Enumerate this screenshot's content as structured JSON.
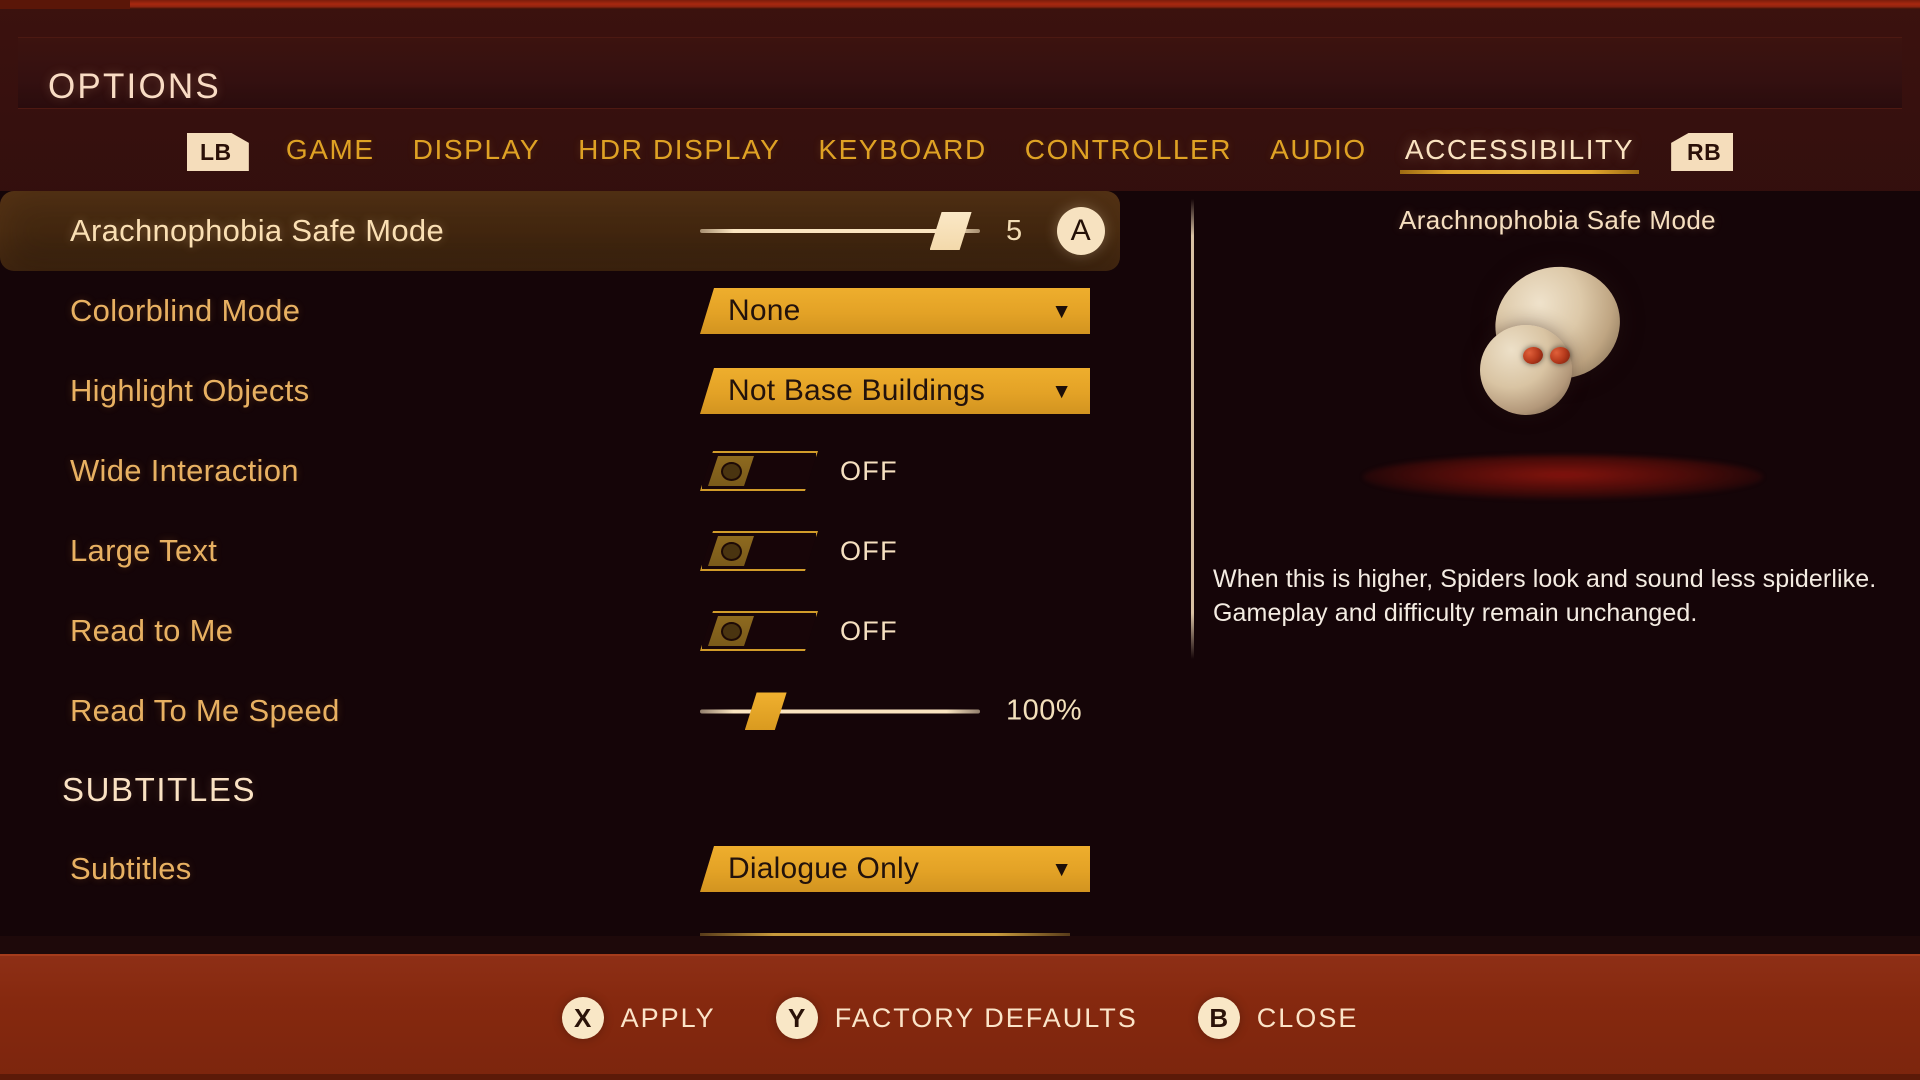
{
  "header": {
    "title": "OPTIONS"
  },
  "tabs": {
    "left_bumper": "LB",
    "right_bumper": "RB",
    "items": [
      {
        "label": "GAME",
        "active": false
      },
      {
        "label": "DISPLAY",
        "active": false
      },
      {
        "label": "HDR DISPLAY",
        "active": false
      },
      {
        "label": "KEYBOARD",
        "active": false
      },
      {
        "label": "CONTROLLER",
        "active": false
      },
      {
        "label": "AUDIO",
        "active": false
      },
      {
        "label": "ACCESSIBILITY",
        "active": true
      }
    ]
  },
  "options": [
    {
      "label": "Arachnophobia Safe Mode",
      "control": "slider",
      "value": "5",
      "fill_percent": 82,
      "selected": true,
      "badge": "A"
    },
    {
      "label": "Colorblind Mode",
      "control": "dropdown",
      "value": "None",
      "selected": false
    },
    {
      "label": "Highlight Objects",
      "control": "dropdown",
      "value": "Not Base Buildings",
      "selected": false
    },
    {
      "label": "Wide Interaction",
      "control": "toggle",
      "value": "OFF",
      "selected": false
    },
    {
      "label": "Large Text",
      "control": "toggle",
      "value": "OFF",
      "selected": false
    },
    {
      "label": "Read to Me",
      "control": "toggle",
      "value": "OFF",
      "selected": false
    },
    {
      "label": "Read To Me Speed",
      "control": "slider",
      "value": "100%",
      "fill_percent": 16,
      "selected": false
    }
  ],
  "section": {
    "subtitles_header": "SUBTITLES",
    "subtitles_row_label": "Subtitles",
    "subtitles_value": "Dialogue Only"
  },
  "preview": {
    "title": "Arachnophobia Safe Mode",
    "description": "When this is higher, Spiders look and sound less spiderlike. Gameplay and difficulty remain unchanged.",
    "image_name": "safe-mode-spider-blob"
  },
  "footer": {
    "buttons": [
      {
        "pad": "X",
        "label": "APPLY"
      },
      {
        "pad": "Y",
        "label": "FACTORY DEFAULTS"
      },
      {
        "pad": "B",
        "label": "CLOSE"
      }
    ]
  },
  "colors": {
    "accent_gold": "#e3a226",
    "label_amber": "#e8b162",
    "cream": "#fae2c3",
    "panel_dark": "#150508",
    "footer_red": "#86290f",
    "selected_row": "#4a2c12"
  }
}
